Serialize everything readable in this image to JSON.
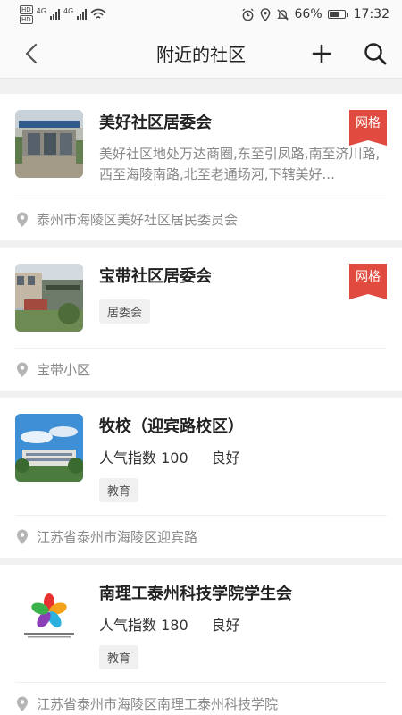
{
  "status_bar": {
    "hd1": "HD",
    "hd2": "HD",
    "net1": "4G",
    "net2": "4G",
    "battery_pct": "66%",
    "battery_level": 0.66,
    "time": "17:32"
  },
  "nav": {
    "title": "附近的社区"
  },
  "communities": [
    {
      "name": "美好社区居委会",
      "badge": "网格",
      "desc": "美好社区地处万达商圈,东至引凤路,南至济川路,西至海陵南路,北至老通场河,下辖美好...",
      "address": "泰州市海陵区美好社区居民委员会"
    },
    {
      "name": "宝带社区居委会",
      "badge": "网格",
      "tag": "居委会",
      "address": "宝带小区"
    },
    {
      "name": "牧校（迎宾路校区）",
      "popularity": "人气指数 100",
      "rating": "良好",
      "tag": "教育",
      "address": "江苏省泰州市海陵区迎宾路"
    },
    {
      "name": "南理工泰州科技学院学生会",
      "popularity": "人气指数 180",
      "rating": "良好",
      "tag": "教育",
      "address": "江苏省泰州市海陵区南理工泰州科技学院"
    }
  ],
  "colors": {
    "badge": "#e04a3f",
    "text_dark": "#222222",
    "text_grey": "#888888",
    "background": "#f1f1f1"
  }
}
